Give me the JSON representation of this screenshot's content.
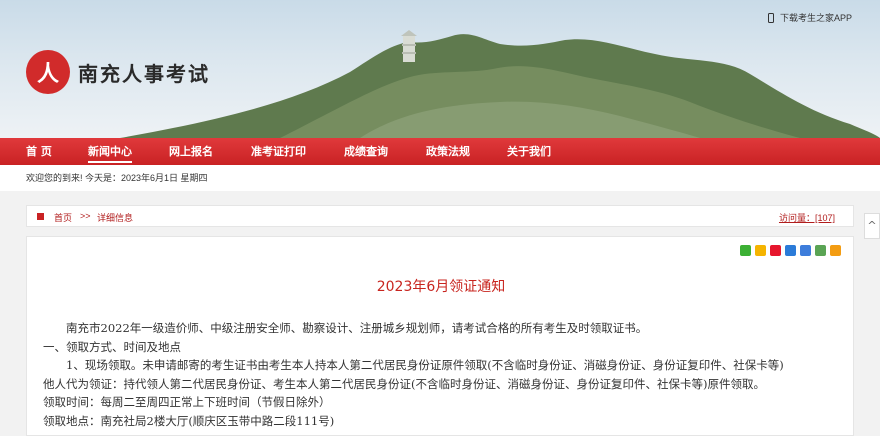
{
  "header": {
    "logo_glyph": "人",
    "site_title": "南充人事考试",
    "app_link": "下载考生之家APP"
  },
  "nav": {
    "items": [
      {
        "label": "首 页"
      },
      {
        "label": "新闻中心"
      },
      {
        "label": "网上报名"
      },
      {
        "label": "准考证打印"
      },
      {
        "label": "成绩查询"
      },
      {
        "label": "政策法规"
      },
      {
        "label": "关于我们"
      }
    ],
    "active_index": 1
  },
  "welcome": {
    "text": "欢迎您的到来!   今天是：2023年6月1日 星期四"
  },
  "breadcrumb": {
    "home": "首页",
    "sep": ">>",
    "current": "详细信息",
    "visits": "访问量：[107]"
  },
  "article": {
    "title": "2023年6月领证通知",
    "paragraphs": [
      "　　南充市2022年一级造价师、中级注册安全师、勘察设计、注册城乡规划师，请考试合格的所有考生及时领取证书。",
      "一、领取方式、时间及地点",
      "　　1、现场领取。未申请邮寄的考生证书由考生本人持本人第二代居民身份证原件领取(不含临时身份证、消磁身份证、身份证复印件、社保卡等)",
      "他人代为领证：持代领人第二代居民身份证、考生本人第二代居民身份证(不含临时身份证、消磁身份证、身份证复印件、社保卡等)原件领取。",
      "领取时间：每周二至周四正常上下班时间（节假日除外）",
      "领取地点：南充社局2楼大厅(顺庆区玉带中路二段111号)"
    ]
  },
  "share": {
    "icons": [
      "wechat-icon",
      "qzone-icon",
      "weibo-icon",
      "baidu-icon",
      "tieba-icon",
      "douban-icon",
      "more-icon"
    ],
    "colors": [
      "#3cb034",
      "#f5b400",
      "#e6162d",
      "#2b7bd8",
      "#3d7ddb",
      "#5aa454",
      "#f39c12"
    ]
  }
}
